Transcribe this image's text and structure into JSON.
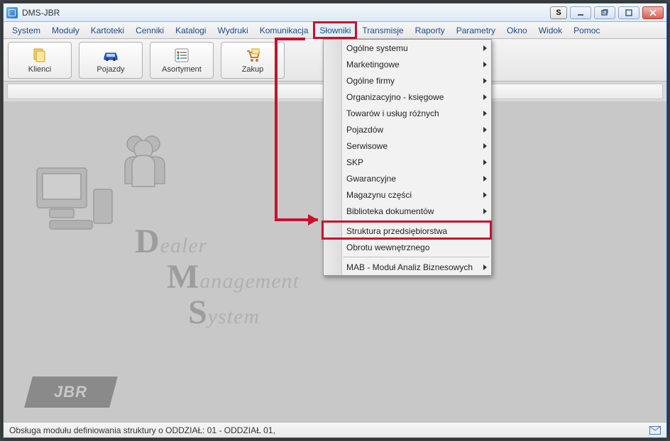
{
  "window": {
    "title": "DMS-JBR"
  },
  "title_controls": {
    "s_label": "S"
  },
  "menubar": [
    "System",
    "Moduły",
    "Kartoteki",
    "Cenniki",
    "Katalogi",
    "Wydruki",
    "Komunikacja",
    "Słowniki",
    "Transmisje",
    "Raporty",
    "Parametry",
    "Okno",
    "Widok",
    "Pomoc"
  ],
  "active_menu_index": 7,
  "toolbar": [
    {
      "label": "Klienci",
      "icon": "clients"
    },
    {
      "label": "Pojazdy",
      "icon": "car"
    },
    {
      "label": "Asortyment",
      "icon": "list"
    },
    {
      "label": "Zakup",
      "icon": "cart"
    }
  ],
  "dropdown": {
    "items": [
      {
        "label": "Ogólne systemu",
        "submenu": true
      },
      {
        "label": "Marketingowe",
        "submenu": true
      },
      {
        "label": "Ogólne firmy",
        "submenu": true
      },
      {
        "label": "Organizacyjno - księgowe",
        "submenu": true
      },
      {
        "label": "Towarów i usług różnych",
        "submenu": true
      },
      {
        "label": "Pojazdów",
        "submenu": true
      },
      {
        "label": "Serwisowe",
        "submenu": true
      },
      {
        "label": "SKP",
        "submenu": true
      },
      {
        "label": "Gwarancyjne",
        "submenu": true
      },
      {
        "label": "Magazynu części",
        "submenu": true
      },
      {
        "label": "Biblioteka dokumentów",
        "submenu": true
      },
      {
        "label": "Struktura przedsiębiorstwa",
        "submenu": false
      },
      {
        "label": "Obrotu wewnętrznego",
        "submenu": false
      },
      {
        "label": "MAB - Moduł Analiz Biznesowych",
        "submenu": true
      }
    ],
    "separators_after": [
      10,
      12
    ],
    "highlighted_index": 11
  },
  "watermark": {
    "line1_cap": "D",
    "line1_rest": "ealer",
    "line2_cap": "M",
    "line2_rest": "anagement",
    "line3_cap": "S",
    "line3_rest": "ystem",
    "badge": "JBR"
  },
  "statusbar": {
    "text": "Obsługa modułu definiowania struktury o  ODDZIAŁ: 01 - ODDZIAŁ 01,"
  },
  "colors": {
    "highlight": "#c8102e",
    "menu_text": "#1a4b8c"
  }
}
